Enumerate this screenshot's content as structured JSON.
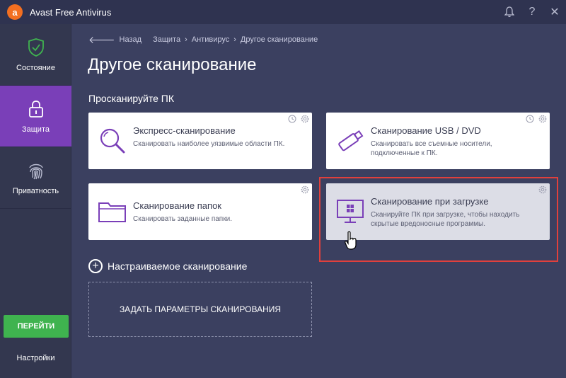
{
  "titlebar": {
    "title": "Avast Free Antivirus",
    "logo_letter": "a",
    "brand_color": "#f36f21",
    "controls": [
      "bell-icon",
      "help-icon",
      "close-icon"
    ],
    "help_label": "?",
    "close_label": "✕"
  },
  "sidebar": {
    "items": [
      {
        "label": "Состояние",
        "icon": "shield-check-icon"
      },
      {
        "label": "Защита",
        "icon": "lock-icon",
        "active": true
      },
      {
        "label": "Приватность",
        "icon": "fingerprint-icon"
      }
    ],
    "go_button": "ПЕРЕЙТИ",
    "settings": "Настройки"
  },
  "breadcrumb": {
    "back": "Назад",
    "items": [
      "Защита",
      "Антивирус",
      "Другое сканирование"
    ]
  },
  "page_title": "Другое сканирование",
  "section_title": "Просканируйте ПК",
  "cards": [
    {
      "title": "Экспресс-сканирование",
      "desc": "Сканировать наиболее уязвимые области ПК.",
      "icon": "magnifier-icon"
    },
    {
      "title": "Сканирование USB / DVD",
      "desc": "Сканировать все съемные носители, подключенные к ПК.",
      "icon": "usb-drive-icon"
    },
    {
      "title": "Сканирование папок",
      "desc": "Сканировать заданные папки.",
      "icon": "folder-icon"
    },
    {
      "title": "Сканирование при загрузке",
      "desc": "Сканируйте ПК при загрузке, чтобы находить скрытые вредоносные программы.",
      "icon": "windows-monitor-icon"
    }
  ],
  "custom_scan": {
    "label": "Настраиваемое сканирование",
    "box_label": "ЗАДАТЬ ПАРАМЕТРЫ СКАНИРОВАНИЯ"
  },
  "colors": {
    "accent": "#7a3fb8",
    "go_green": "#3fb34f",
    "highlight_red": "#e0403c",
    "background": "#3b4060"
  }
}
